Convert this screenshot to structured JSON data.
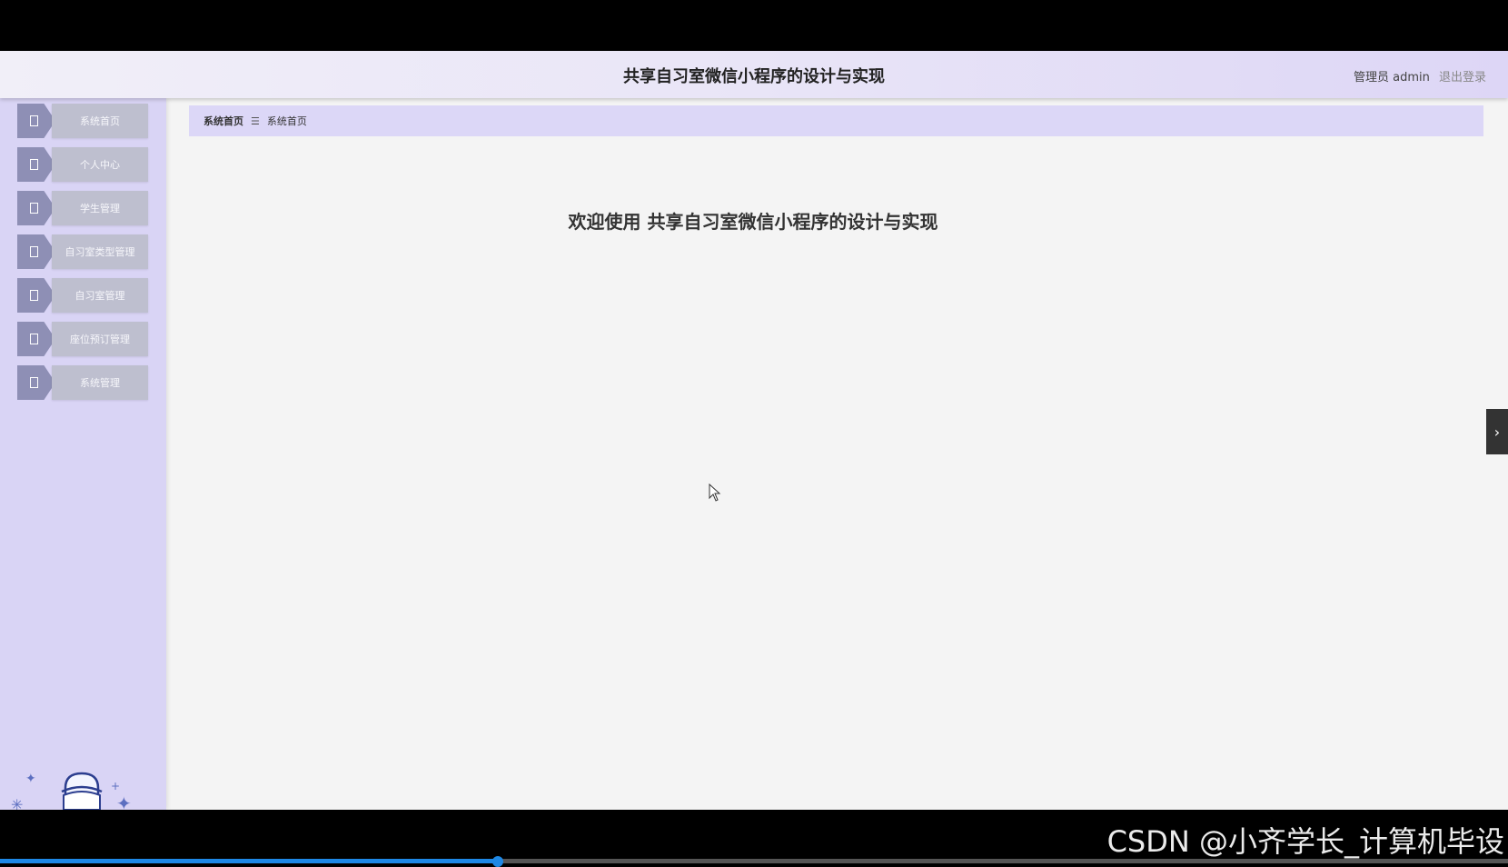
{
  "header": {
    "title": "共享自习室微信小程序的设计与实现",
    "user_label": "管理员 admin",
    "logout_label": "退出登录"
  },
  "sidebar": {
    "items": [
      {
        "label": "系统首页"
      },
      {
        "label": "个人中心"
      },
      {
        "label": "学生管理"
      },
      {
        "label": "自习室类型管理"
      },
      {
        "label": "自习室管理"
      },
      {
        "label": "座位预订管理"
      },
      {
        "label": "系统管理"
      }
    ]
  },
  "breadcrumb": {
    "root": "系统首页",
    "separator": "☰",
    "current": "系统首页"
  },
  "main": {
    "welcome": "欢迎使用 共享自习室微信小程序的设计与实现"
  },
  "video": {
    "watermark": "CSDN @小齐学长_计算机毕设",
    "progress": 0.33
  },
  "colors": {
    "accent": "#dcd7f7",
    "sidebar_bg": "#d9d4f5",
    "menu_tab": "#8e8fb5",
    "progress": "#1e88e5"
  },
  "icons": {
    "menu_tab": "arrow-tab-icon",
    "side_toggle": "chevron-right-icon",
    "cursor": "mouse-cursor-icon"
  }
}
